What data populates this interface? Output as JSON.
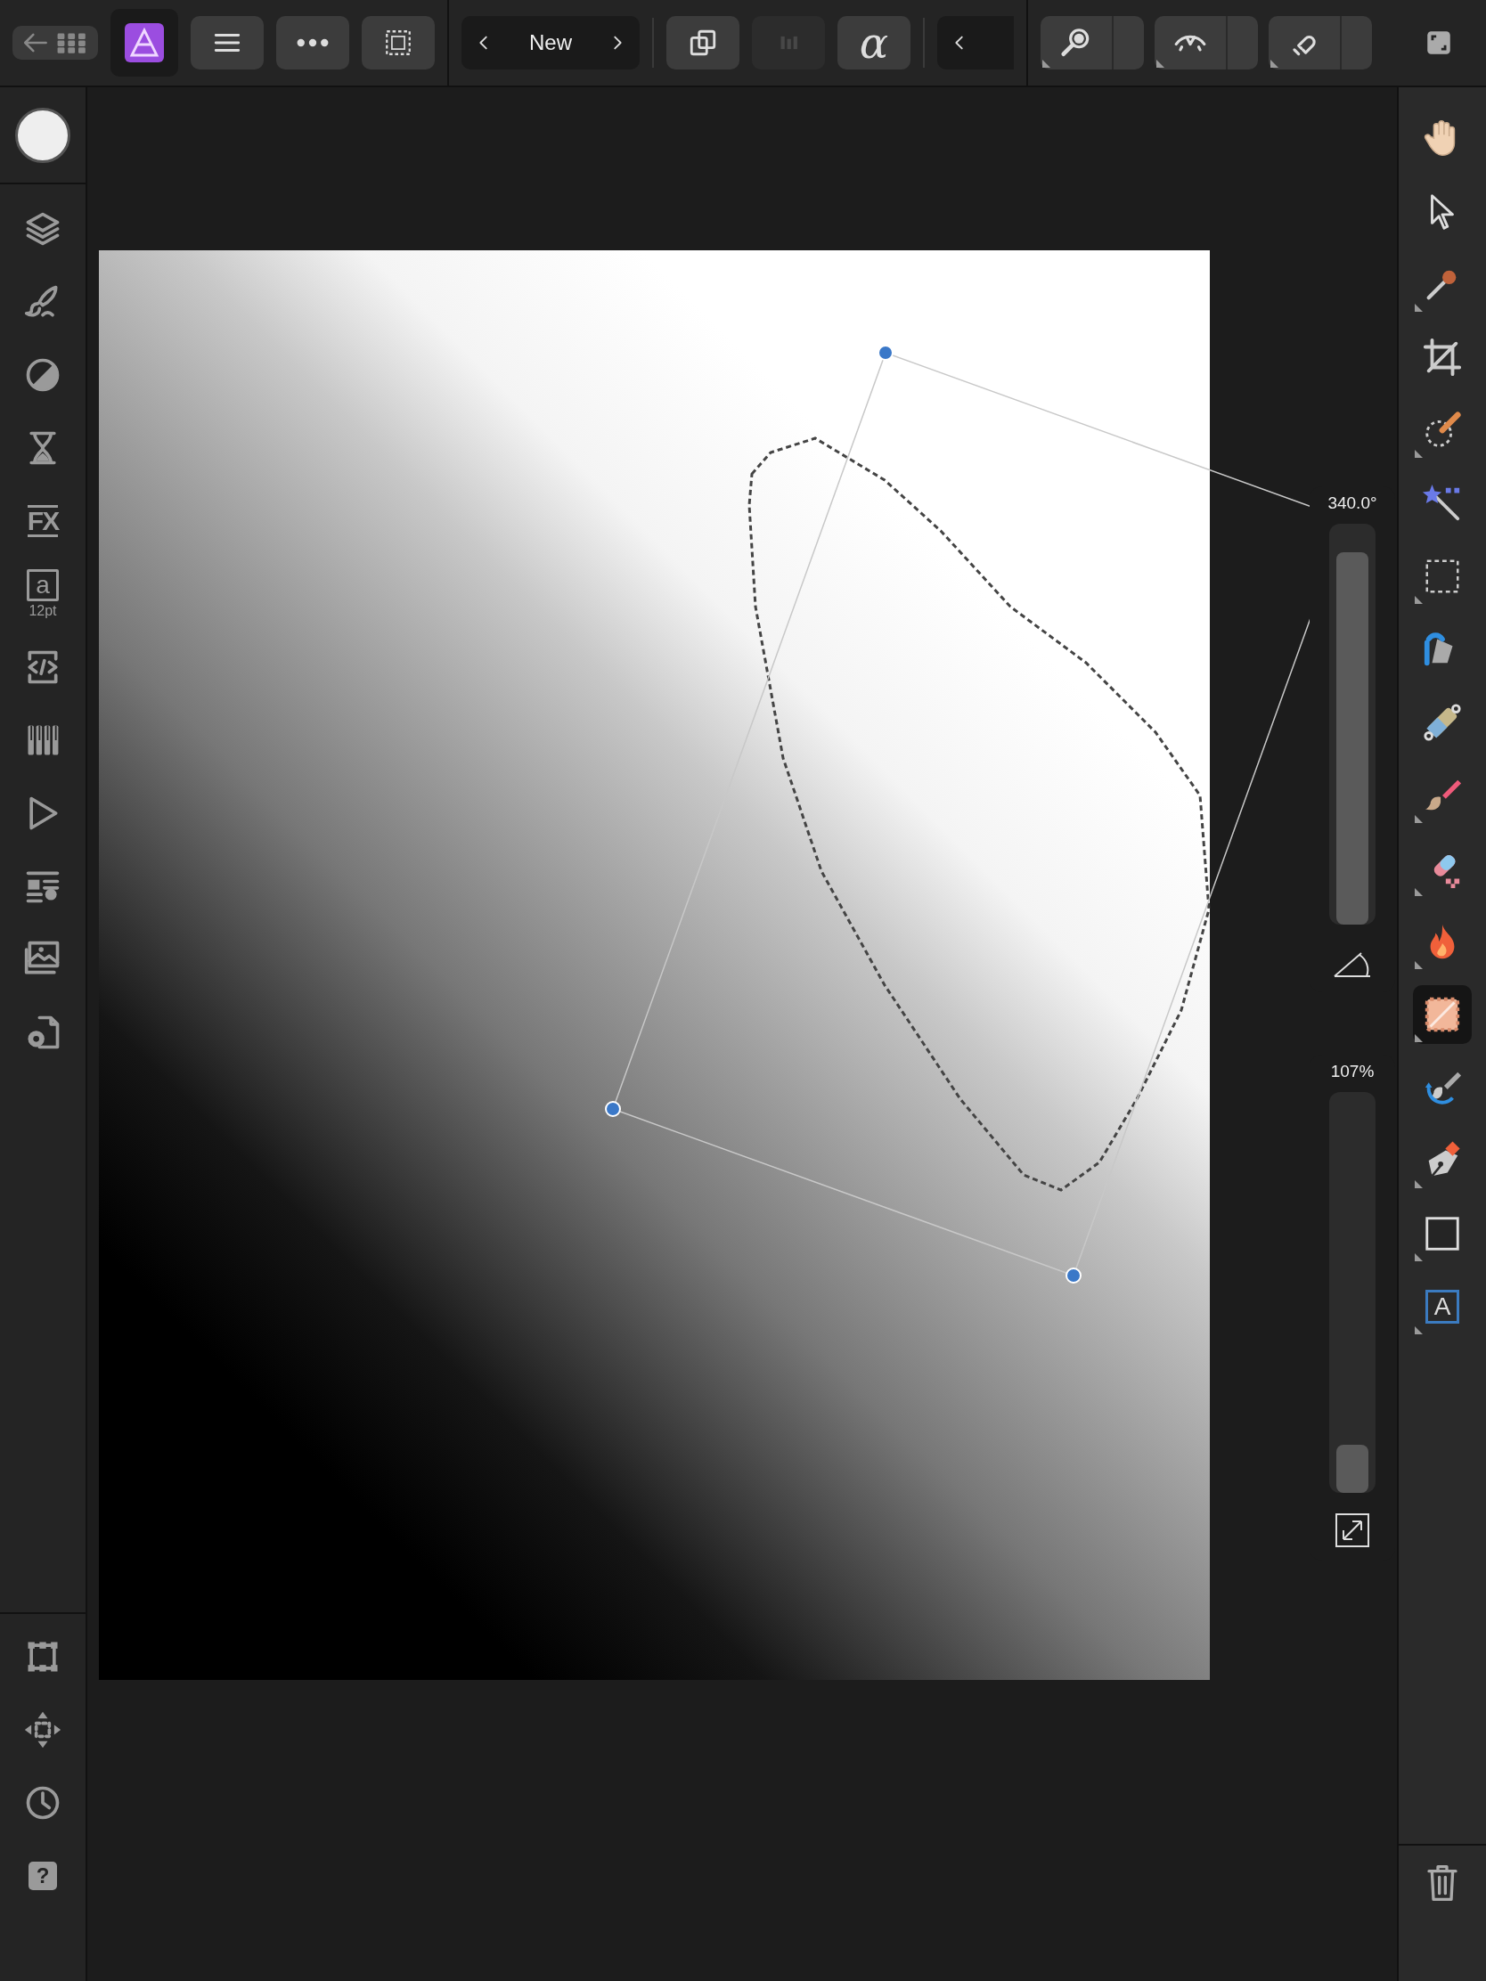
{
  "top_bar": {
    "left": [
      {
        "kind": "back-grid"
      },
      {
        "kind": "app-logo"
      },
      {
        "kind": "menu"
      },
      {
        "kind": "more"
      },
      {
        "kind": "marquee"
      }
    ],
    "history": {
      "label": "New"
    },
    "actions": [
      {
        "kind": "copy",
        "disabled": false
      },
      {
        "kind": "blur",
        "disabled": true
      },
      {
        "kind": "glyph",
        "label": "α",
        "disabled": false
      }
    ],
    "collapse": {
      "kind": "chevron-left"
    },
    "toggles": [
      {
        "kind": "zoom",
        "on": false
      },
      {
        "kind": "view",
        "on": false
      },
      {
        "kind": "snap",
        "on": false
      }
    ],
    "fullscreen": {
      "kind": "fullscreen"
    }
  },
  "left_sidebar": {
    "color_swatch": {
      "color": "#eeeeee"
    },
    "studios": [
      {
        "kind": "layers"
      },
      {
        "kind": "brush"
      },
      {
        "kind": "adjustment"
      },
      {
        "kind": "hourglass"
      },
      {
        "kind": "fx",
        "label": "FX"
      },
      {
        "kind": "text-style",
        "label": "a",
        "caption": "12pt"
      },
      {
        "kind": "code"
      },
      {
        "kind": "channels"
      },
      {
        "kind": "play"
      },
      {
        "kind": "list"
      },
      {
        "kind": "images"
      },
      {
        "kind": "doc-gear"
      }
    ],
    "bottom": [
      {
        "kind": "transform"
      },
      {
        "kind": "move"
      },
      {
        "kind": "clock"
      },
      {
        "kind": "help",
        "label": "?"
      }
    ]
  },
  "right_toolbar": {
    "tools": [
      {
        "kind": "hand",
        "selected": false,
        "flyout": false
      },
      {
        "kind": "pointer",
        "selected": false,
        "flyout": false
      },
      {
        "kind": "eyedropper",
        "selected": false,
        "flyout": true
      },
      {
        "kind": "crop",
        "selected": false,
        "flyout": false
      },
      {
        "kind": "freehand",
        "selected": false,
        "flyout": true
      },
      {
        "kind": "wand",
        "selected": false,
        "flyout": false
      },
      {
        "kind": "rect-select",
        "selected": false,
        "flyout": true
      },
      {
        "kind": "fill",
        "selected": false,
        "flyout": false
      },
      {
        "kind": "gradient",
        "selected": false,
        "flyout": false
      },
      {
        "kind": "paint",
        "selected": false,
        "flyout": true
      },
      {
        "kind": "eraser",
        "selected": false,
        "flyout": true
      },
      {
        "kind": "burn",
        "selected": false,
        "flyout": true
      },
      {
        "kind": "selection-brush",
        "selected": true,
        "flyout": true
      },
      {
        "kind": "retouch",
        "selected": false,
        "flyout": false
      },
      {
        "kind": "pen",
        "selected": false,
        "flyout": true
      },
      {
        "kind": "rectangle",
        "selected": false,
        "flyout": true
      },
      {
        "kind": "text-frame",
        "label": "A",
        "selected": false,
        "flyout": true
      }
    ],
    "trash": {
      "kind": "trash"
    }
  },
  "sliders": [
    {
      "kind": "angle",
      "reading": "340.0°",
      "level": 0.93
    },
    {
      "kind": "scale",
      "reading": "107%",
      "level": 0.12
    }
  ]
}
